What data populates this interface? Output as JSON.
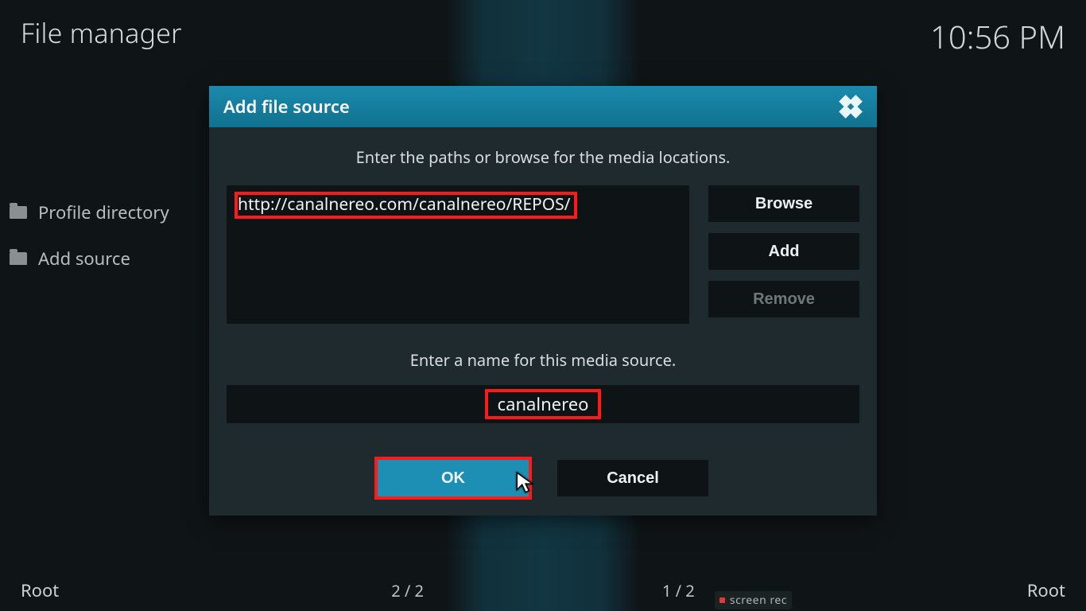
{
  "header": {
    "title": "File manager",
    "time": "10:56 PM"
  },
  "sidebar": {
    "items": [
      {
        "label": "Profile directory"
      },
      {
        "label": "Add source"
      }
    ]
  },
  "footer": {
    "left": "Root",
    "center_left": "2 / 2",
    "center_right": "1 / 2",
    "right": "Root"
  },
  "screenrec": {
    "label": "screen rec"
  },
  "dialog": {
    "title": "Add file source",
    "prompt_paths": "Enter the paths or browse for the media locations.",
    "path_value": "http://canalnereo.com/canalnereo/REPOS/",
    "browse": "Browse",
    "add": "Add",
    "remove": "Remove",
    "prompt_name": "Enter a name for this media source.",
    "name_value": "canalnereo",
    "ok": "OK",
    "cancel": "Cancel"
  }
}
